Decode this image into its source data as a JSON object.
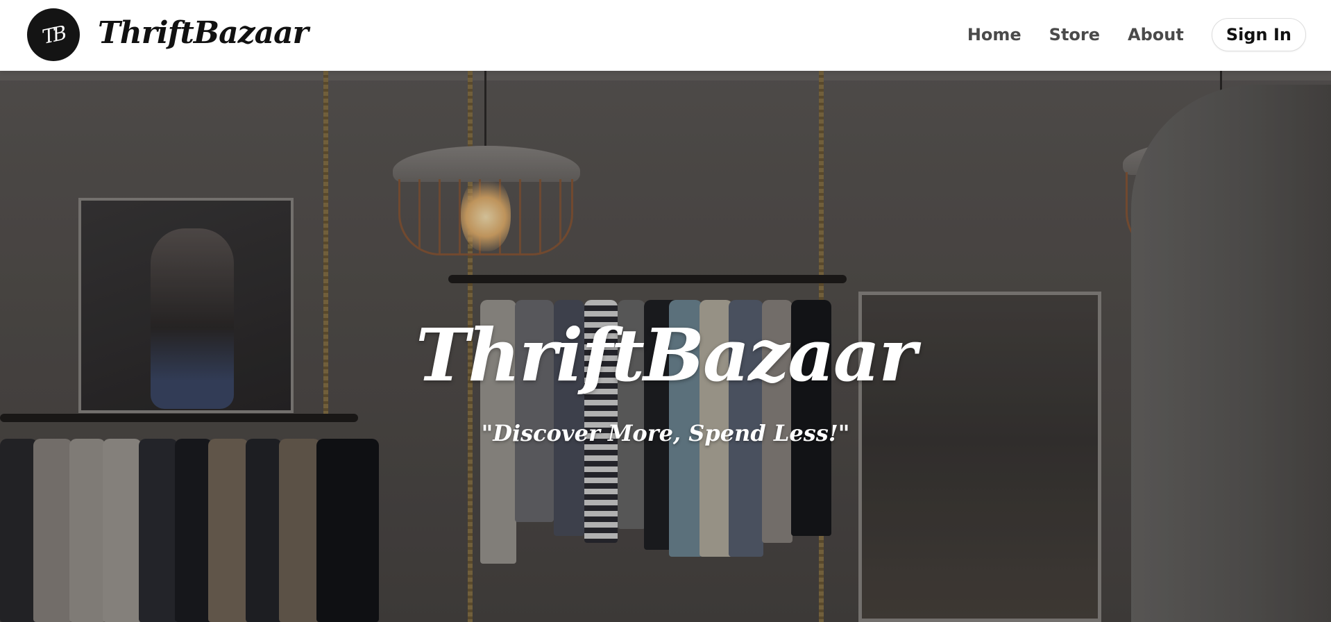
{
  "header": {
    "logo_monogram": "TB",
    "brand_name": "ThriftBazaar",
    "nav_links": [
      {
        "label": "Home"
      },
      {
        "label": "Store"
      },
      {
        "label": "About"
      }
    ],
    "sign_in_label": "Sign In"
  },
  "hero": {
    "title": "ThriftBazaar",
    "tagline": "\"Discover More, Spend Less!\"",
    "background_icon": "clothing-store-photo"
  },
  "colors": {
    "header_bg": "#ffffff",
    "brand_text": "#111111",
    "nav_text": "#4a4a4a",
    "hero_text": "#ffffff",
    "logo_bg": "#141414"
  }
}
